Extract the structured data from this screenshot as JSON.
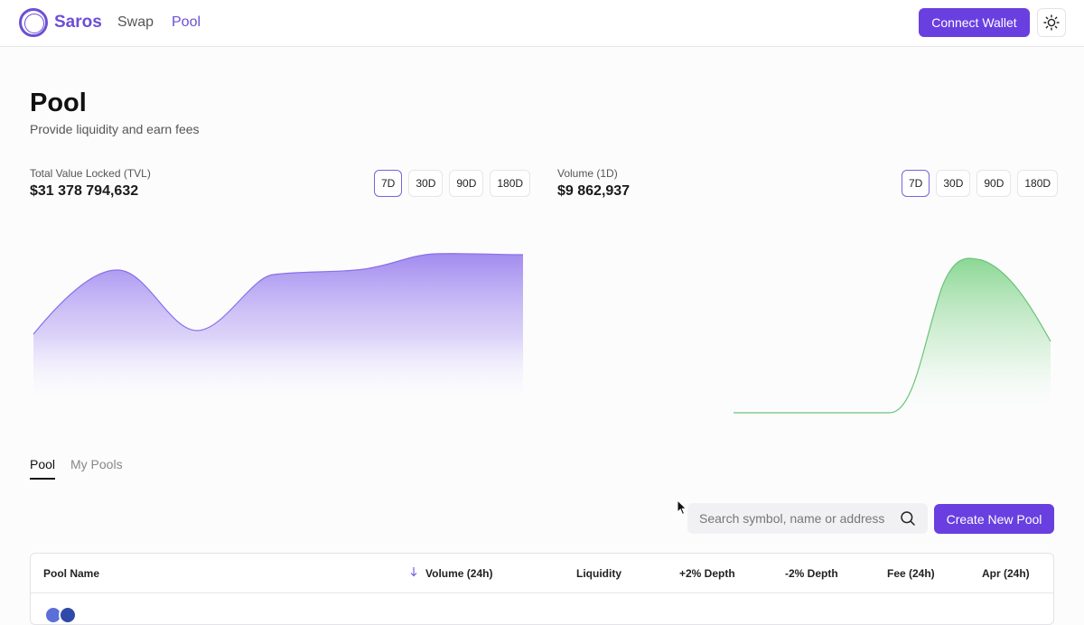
{
  "header": {
    "brand": "Saros",
    "nav": [
      "Swap",
      "Pool"
    ],
    "connect_wallet": "Connect Wallet",
    "theme_icon": "sun-icon",
    "accent": "#6a3fe0"
  },
  "page": {
    "title": "Pool",
    "subtitle": "Provide liquidity and earn fees"
  },
  "tvl": {
    "label": "Total Value Locked (TVL)",
    "value": "$31 378 794,632",
    "ranges": [
      "7D",
      "30D",
      "90D",
      "180D"
    ],
    "active_range": "7D",
    "color": "#9d85ef"
  },
  "volume": {
    "label": "Volume (1D)",
    "value": "$9 862,937",
    "ranges": [
      "7D",
      "30D",
      "90D",
      "180D"
    ],
    "active_range": "7D",
    "color": "#7fd389"
  },
  "tabs": [
    "Pool",
    "My Pools"
  ],
  "search": {
    "placeholder": "Search symbol, name or address",
    "icon": "search-icon"
  },
  "create_pool": "Create New Pool",
  "table": {
    "columns": [
      "Pool Name",
      "Volume (24h)",
      "Liquidity",
      "+2% Depth",
      "-2% Depth",
      "Fee (24h)",
      "Apr (24h)"
    ],
    "sort_column": "Volume (24h)",
    "sort_direction": "desc"
  }
}
